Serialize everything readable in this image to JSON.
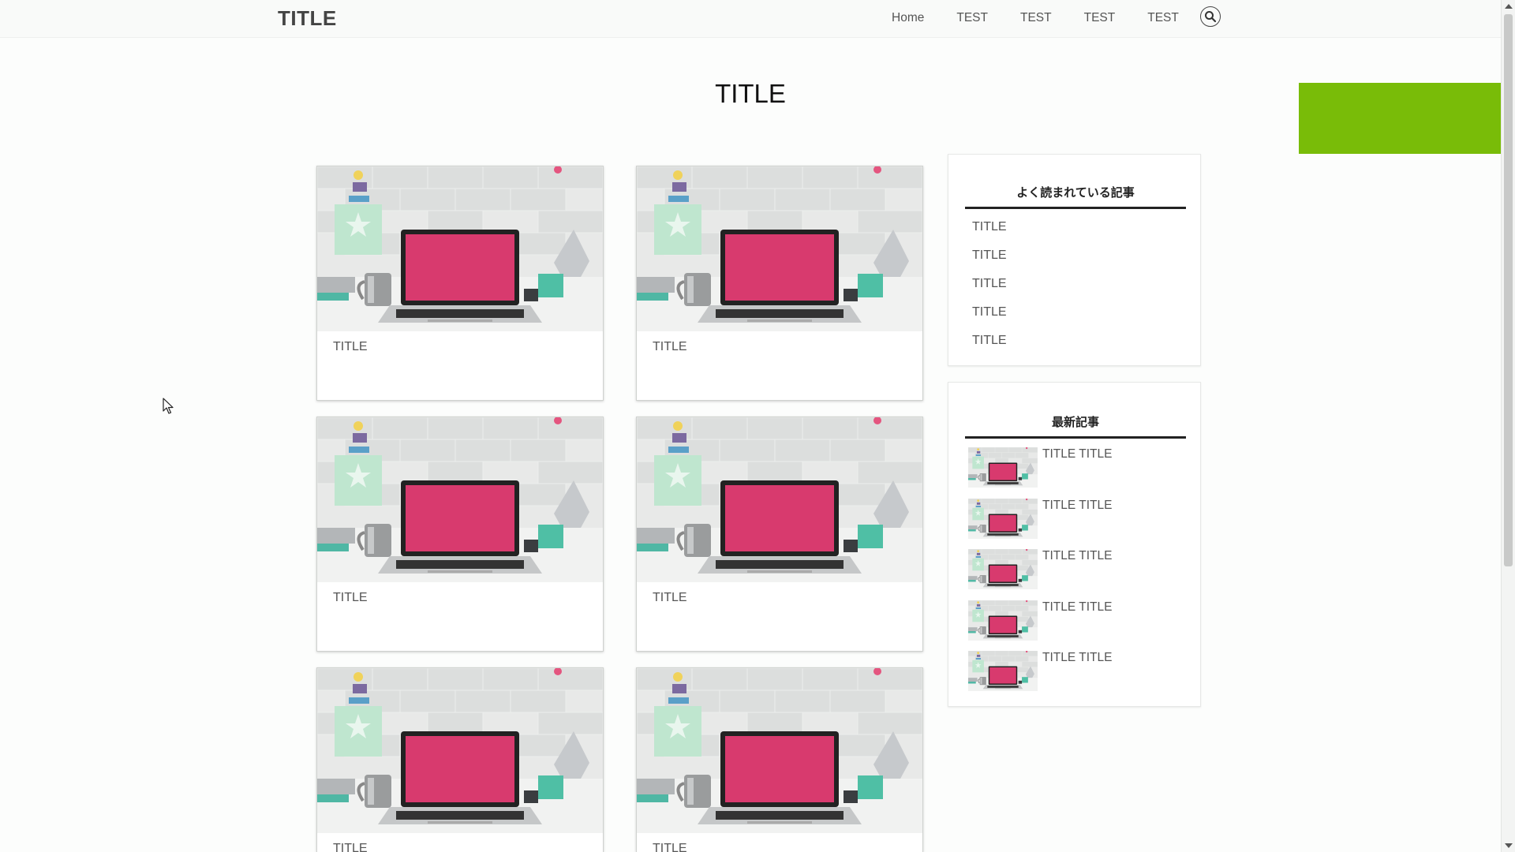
{
  "header": {
    "site_title": "TITLE",
    "nav": [
      "Home",
      "TEST",
      "TEST",
      "TEST",
      "TEST"
    ],
    "search_icon": "search-icon"
  },
  "main": {
    "page_title": "TITLE",
    "cards": [
      {
        "title": "TITLE"
      },
      {
        "title": "TITLE"
      },
      {
        "title": "TITLE"
      },
      {
        "title": "TITLE"
      },
      {
        "title": "TITLE"
      },
      {
        "title": "TITLE"
      }
    ]
  },
  "sidebar": {
    "popular": {
      "heading": "よく読まれている記事",
      "items": [
        "TITLE",
        "TITLE",
        "TITLE",
        "TITLE",
        "TITLE"
      ]
    },
    "recent": {
      "heading": "最新記事",
      "items": [
        "TITLE TITLE",
        "TITLE TITLE",
        "TITLE TITLE",
        "TITLE TITLE",
        "TITLE TITLE"
      ]
    }
  },
  "colors": {
    "accent_green": "#79bc08",
    "laptop_screen": "#d83a6e",
    "heading_rule": "#222222"
  }
}
